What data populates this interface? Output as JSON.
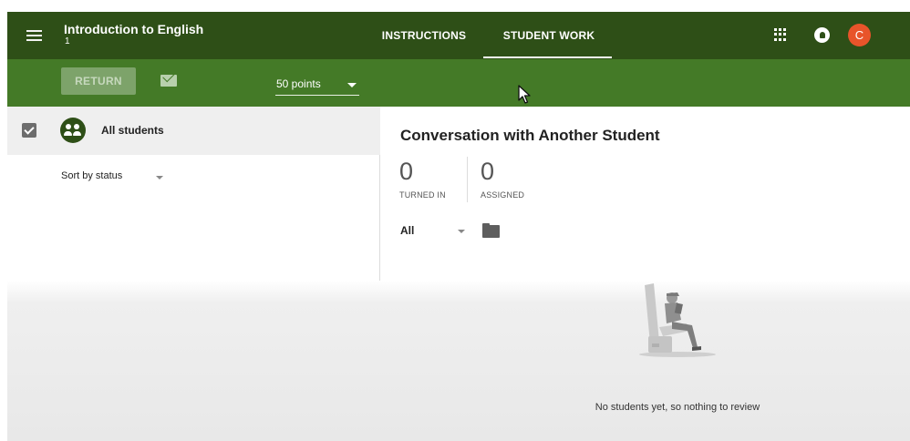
{
  "header": {
    "course_title": "Introduction to English",
    "course_section": "1",
    "tabs": [
      {
        "label": "INSTRUCTIONS",
        "active": false
      },
      {
        "label": "STUDENT WORK",
        "active": true
      }
    ],
    "avatar_initial": "C",
    "icons": [
      "menu-icon",
      "apps-grid-icon",
      "notifications-icon"
    ]
  },
  "toolbar": {
    "return_label": "RETURN",
    "return_enabled": false,
    "points_value": "50 points"
  },
  "students_panel": {
    "all_students_label": "All students",
    "all_students_checked": true,
    "sort_value": "Sort by status"
  },
  "assignment": {
    "title": "Conversation with Another Student",
    "stats": [
      {
        "value": "0",
        "label": "TURNED IN"
      },
      {
        "value": "0",
        "label": "ASSIGNED"
      }
    ],
    "filter_value": "All",
    "empty_message": "No students yet, so nothing to review"
  },
  "colors": {
    "header_bg": "#2e4f17",
    "toolbar_bg": "#447a27",
    "avatar_bg": "#e8542a"
  }
}
